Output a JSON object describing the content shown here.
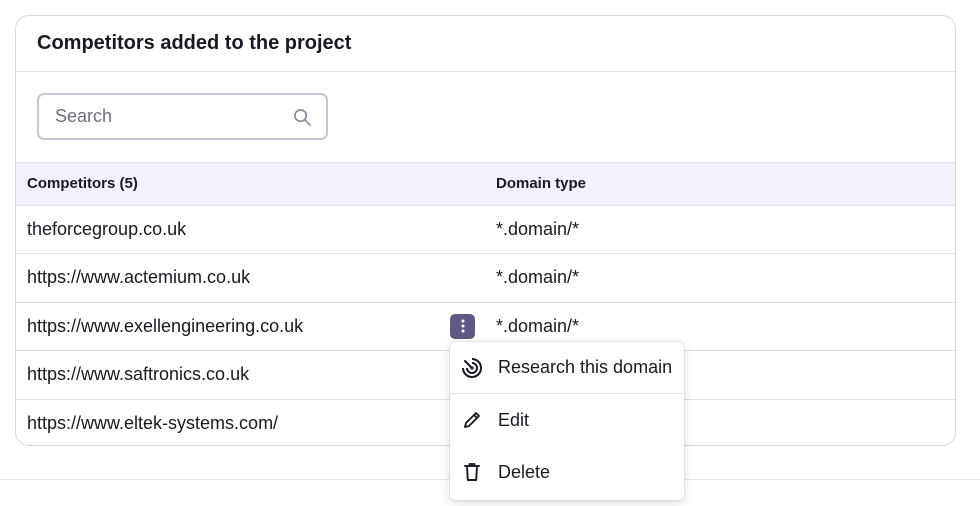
{
  "card": {
    "title": "Competitors added to the project"
  },
  "search": {
    "placeholder": "Search",
    "value": ""
  },
  "table": {
    "headers": {
      "competitors": "Competitors (5)",
      "domain_type": "Domain type"
    },
    "rows": [
      {
        "competitor": "theforcegroup.co.uk",
        "domain_type": "*.domain/*"
      },
      {
        "competitor": "https://www.actemium.co.uk",
        "domain_type": "*.domain/*"
      },
      {
        "competitor": "https://www.exellengineering.co.uk",
        "domain_type": "*.domain/*"
      },
      {
        "competitor": "https://www.saftronics.co.uk",
        "domain_type": ""
      },
      {
        "competitor": "https://www.eltek-systems.com/",
        "domain_type": ""
      }
    ]
  },
  "context_menu": {
    "items": [
      {
        "label": "Research this domain",
        "icon": "radar-icon"
      },
      {
        "label": "Edit",
        "icon": "pencil-icon"
      },
      {
        "label": "Delete",
        "icon": "trash-icon"
      }
    ]
  },
  "colors": {
    "kebab_bg": "#5f5a84",
    "header_bg": "#f1f2fb",
    "border": "#d6d8e0"
  }
}
